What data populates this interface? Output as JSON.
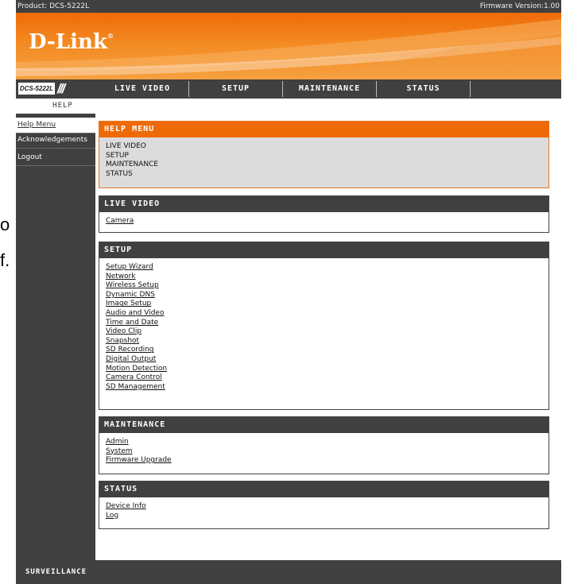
{
  "topbar": {
    "product": "Product: DCS-5222L",
    "firmware": "Firmware Version:1.00"
  },
  "brand": {
    "logo": "D-Link",
    "reg_mark": "®",
    "model": "DCS-5222L",
    "slashes": "///"
  },
  "nav": {
    "tabs": [
      "LIVE VIDEO",
      "SETUP",
      "MAINTENANCE",
      "STATUS"
    ]
  },
  "help_tab": "HELP",
  "sidebar": {
    "items": [
      "Help Menu",
      "Acknowledgements",
      "Logout"
    ]
  },
  "sections": {
    "help_menu": {
      "title": "HELP MENU",
      "items": [
        "LIVE VIDEO",
        "SETUP",
        "MAINTENANCE",
        "STATUS"
      ]
    },
    "live_video": {
      "title": "LIVE VIDEO",
      "links": [
        "Camera"
      ]
    },
    "setup": {
      "title": "SETUP",
      "links": [
        "Setup Wizard",
        "Network",
        "Wireless Setup",
        "Dynamic DNS",
        "Image Setup",
        "Audio and Video",
        "Time and Date",
        "Video Clip",
        "Snapshot",
        "SD Recording",
        "Digital Output",
        "Motion Detection",
        "Camera Control",
        "SD Management"
      ]
    },
    "maintenance": {
      "title": "MAINTENANCE",
      "links": [
        "Admin",
        "System",
        "Firmware Upgrade"
      ]
    },
    "status": {
      "title": "STATUS",
      "links": [
        "Device Info",
        "Log"
      ]
    }
  },
  "footer": {
    "label": "SURVEILLANCE"
  },
  "outside_text": [
    "o",
    "f."
  ],
  "colors": {
    "accent": "#ee6a08",
    "dark": "#404040"
  }
}
